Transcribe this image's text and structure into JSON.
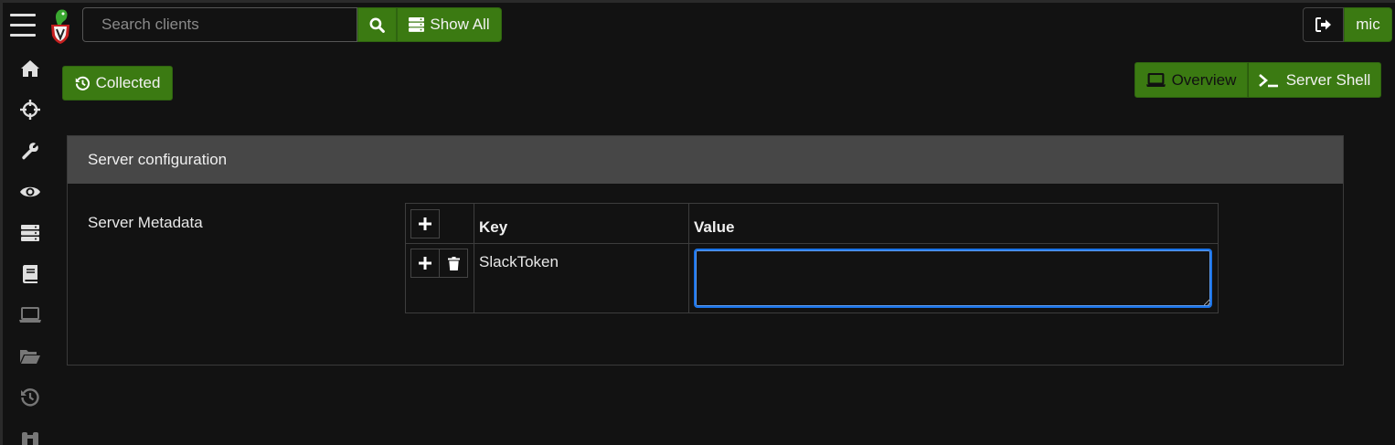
{
  "header": {
    "search_placeholder": "Search clients",
    "show_all_label": "Show All",
    "user_label": "mic"
  },
  "toolbar": {
    "collected_label": "Collected",
    "overview_label": "Overview",
    "server_shell_label": "Server Shell"
  },
  "sidebar": {
    "items": [
      {
        "icon": "home-icon"
      },
      {
        "icon": "crosshairs-icon"
      },
      {
        "icon": "wrench-icon"
      },
      {
        "icon": "eye-icon"
      },
      {
        "icon": "server-icon"
      },
      {
        "icon": "book-icon"
      },
      {
        "icon": "laptop-icon"
      },
      {
        "icon": "folder-open-icon"
      },
      {
        "icon": "history-icon"
      },
      {
        "icon": "binoculars-icon"
      }
    ]
  },
  "panel": {
    "title": "Server configuration",
    "metadata_label": "Server Metadata",
    "columns": {
      "key": "Key",
      "value": "Value"
    },
    "rows": [
      {
        "key": "SlackToken",
        "value": ""
      }
    ]
  },
  "colors": {
    "accent_green": "#3b7a12",
    "focus_blue": "#1a73e8",
    "panel_header": "#474747",
    "background": "#121212"
  }
}
